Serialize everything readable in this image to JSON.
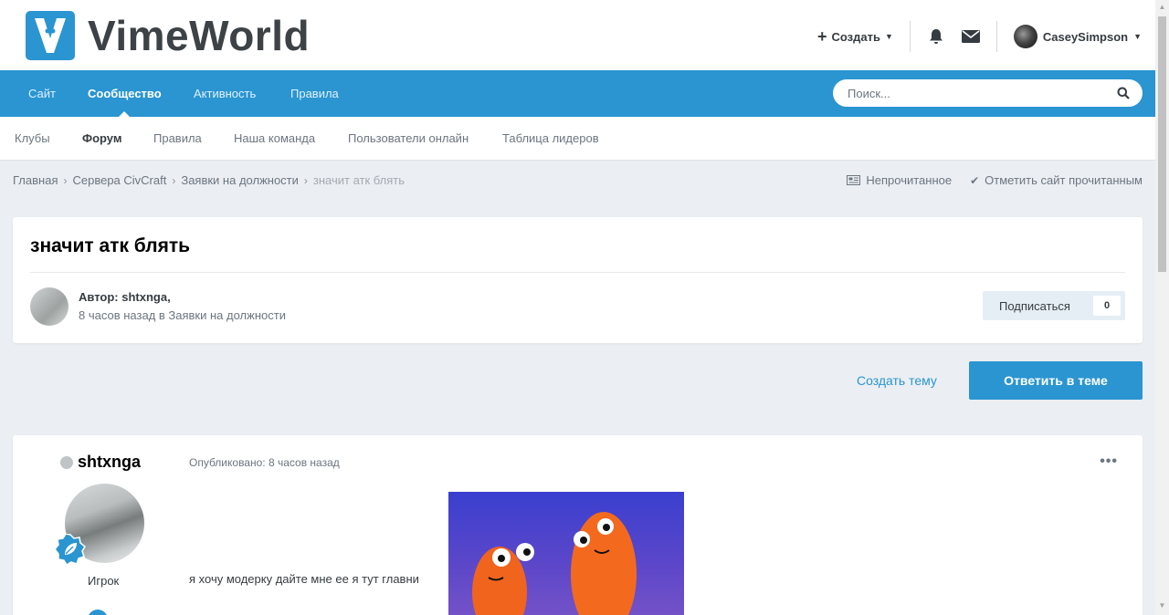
{
  "header": {
    "logo_text": "VimeWorld",
    "create_label": "Создать",
    "username": "CaseySimpson"
  },
  "nav": {
    "items": [
      {
        "label": "Сайт",
        "active": false
      },
      {
        "label": "Сообщество",
        "active": true
      },
      {
        "label": "Активность",
        "active": false
      },
      {
        "label": "Правила",
        "active": false
      }
    ],
    "search_placeholder": "Поиск..."
  },
  "subnav": {
    "items": [
      {
        "label": "Клубы",
        "active": false
      },
      {
        "label": "Форум",
        "active": true
      },
      {
        "label": "Правила",
        "active": false
      },
      {
        "label": "Наша команда",
        "active": false
      },
      {
        "label": "Пользователи онлайн",
        "active": false
      },
      {
        "label": "Таблица лидеров",
        "active": false
      }
    ]
  },
  "breadcrumb": {
    "items": [
      "Главная",
      "Сервера CivCraft",
      "Заявки на должности"
    ],
    "current": "значит атк блять",
    "unread_label": "Непрочитанное",
    "mark_read_label": "Отметить сайт прочитанным"
  },
  "topic": {
    "title": "значит атк блять",
    "author_line": "Автор: shtxnga,",
    "meta": "8 часов назад в Заявки на должности",
    "follow_label": "Подписаться",
    "follow_count": "0"
  },
  "actions": {
    "create_topic": "Создать тему",
    "reply": "Ответить в теме"
  },
  "post": {
    "username": "shtxnga",
    "role": "Игрок",
    "published": "Опубликовано: 8 часов назад",
    "menu": "•••",
    "text": "я хочу модерку  дайте мне ее я тут главни"
  },
  "colors": {
    "brand": "#2a95d1",
    "background": "#ebeef2",
    "text": "#353c41"
  }
}
